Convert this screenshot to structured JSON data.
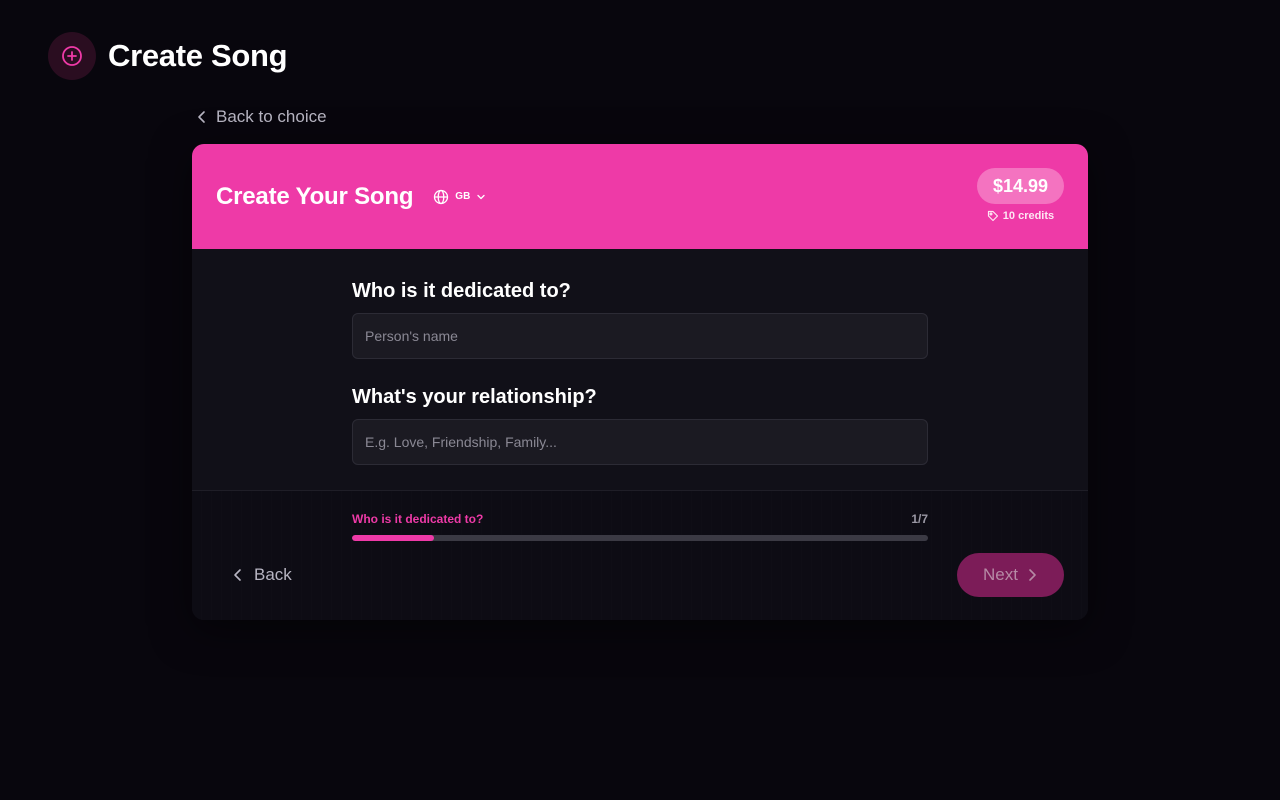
{
  "page": {
    "title": "Create Song",
    "header_icon": "plus-circle-icon"
  },
  "nav": {
    "back_to_choice": "Back to choice"
  },
  "card": {
    "title": "Create Your Song",
    "locale": "GB",
    "price": "$14.99",
    "credits": "10 credits"
  },
  "form": {
    "q1_label": "Who is it dedicated to?",
    "q1_placeholder": "Person's name",
    "q1_value": "",
    "q2_label": "What's your relationship?",
    "q2_placeholder": "E.g. Love, Friendship, Family...",
    "q2_value": ""
  },
  "progress": {
    "step_label": "Who is it dedicated to?",
    "count": "1/7",
    "fraction": 0.143
  },
  "footer": {
    "back_label": "Back",
    "next_label": "Next"
  },
  "colors": {
    "accent": "#ee3aa7",
    "background": "#08060d",
    "card_body": "#111018",
    "next_disabled": "#7c1c58"
  }
}
